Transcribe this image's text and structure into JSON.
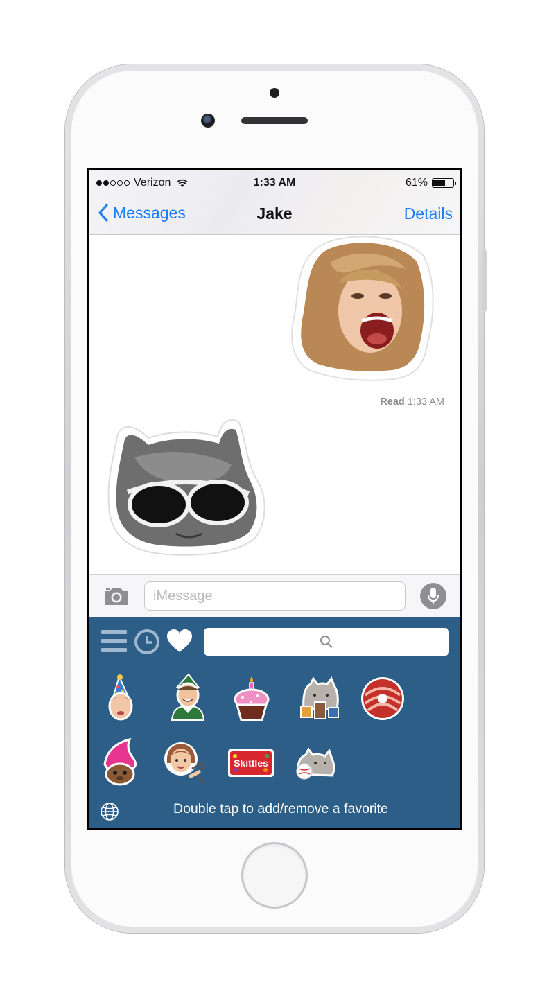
{
  "status_bar": {
    "carrier": "Verizon",
    "signal_bars_filled": 2,
    "signal_bars_total": 5,
    "time": "1:33 AM",
    "battery_percent": "61%",
    "battery_level": 0.61
  },
  "nav": {
    "back_label": "Messages",
    "title": "Jake",
    "details_label": "Details"
  },
  "conversation": {
    "sent_sticker": "screaming-woman-face-sticker",
    "read_label": "Read",
    "read_time": "1:33 AM",
    "received_sticker": "cat-with-sunglasses-sticker"
  },
  "input_bar": {
    "placeholder": "iMessage",
    "camera_icon": "camera-icon",
    "mic_icon": "microphone-icon"
  },
  "keyboard": {
    "toolbar_icons": [
      "menu-icon",
      "recent-clock-icon",
      "favorites-heart-icon"
    ],
    "search_icon": "search-icon",
    "stickers": [
      "party-hat-girl-sticker",
      "elf-man-sticker",
      "cupcake-candle-sticker",
      "pusheen-snacks-sticker",
      "bacon-donut-sticker",
      "pink-troll-sticker",
      "dancing-woman-emoji-sticker",
      "skittles-sticker",
      "pusheen-ball-sticker"
    ],
    "skittles_text": "Skittles",
    "hint": "Double tap to add/remove a favorite",
    "globe_icon": "globe-icon"
  },
  "colors": {
    "ios_blue": "#1b7df6",
    "keyboard_bg": "#2c5e87",
    "toolbar_icon": "#9fb8cf"
  }
}
